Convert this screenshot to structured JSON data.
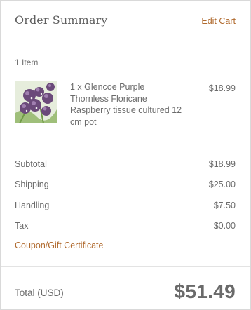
{
  "header": {
    "title": "Order Summary",
    "edit_label": "Edit Cart"
  },
  "items": {
    "count_label": "1 Item",
    "list": [
      {
        "name": "1 x Glencoe Purple Thornless Floricane Raspberry tissue cultured 12 cm pot",
        "price": "$18.99",
        "image_alt": "purple flower thumbnail"
      }
    ]
  },
  "totals": {
    "subtotal_label": "Subtotal",
    "subtotal_value": "$18.99",
    "shipping_label": "Shipping",
    "shipping_value": "$25.00",
    "handling_label": "Handling",
    "handling_value": "$7.50",
    "tax_label": "Tax",
    "tax_value": "$0.00",
    "coupon_label": "Coupon/Gift Certificate"
  },
  "grand_total": {
    "label": "Total (USD)",
    "value": "$51.49"
  },
  "colors": {
    "accent": "#b06a2e",
    "text": "#6b6b6b",
    "divider": "#e3e3e3"
  }
}
